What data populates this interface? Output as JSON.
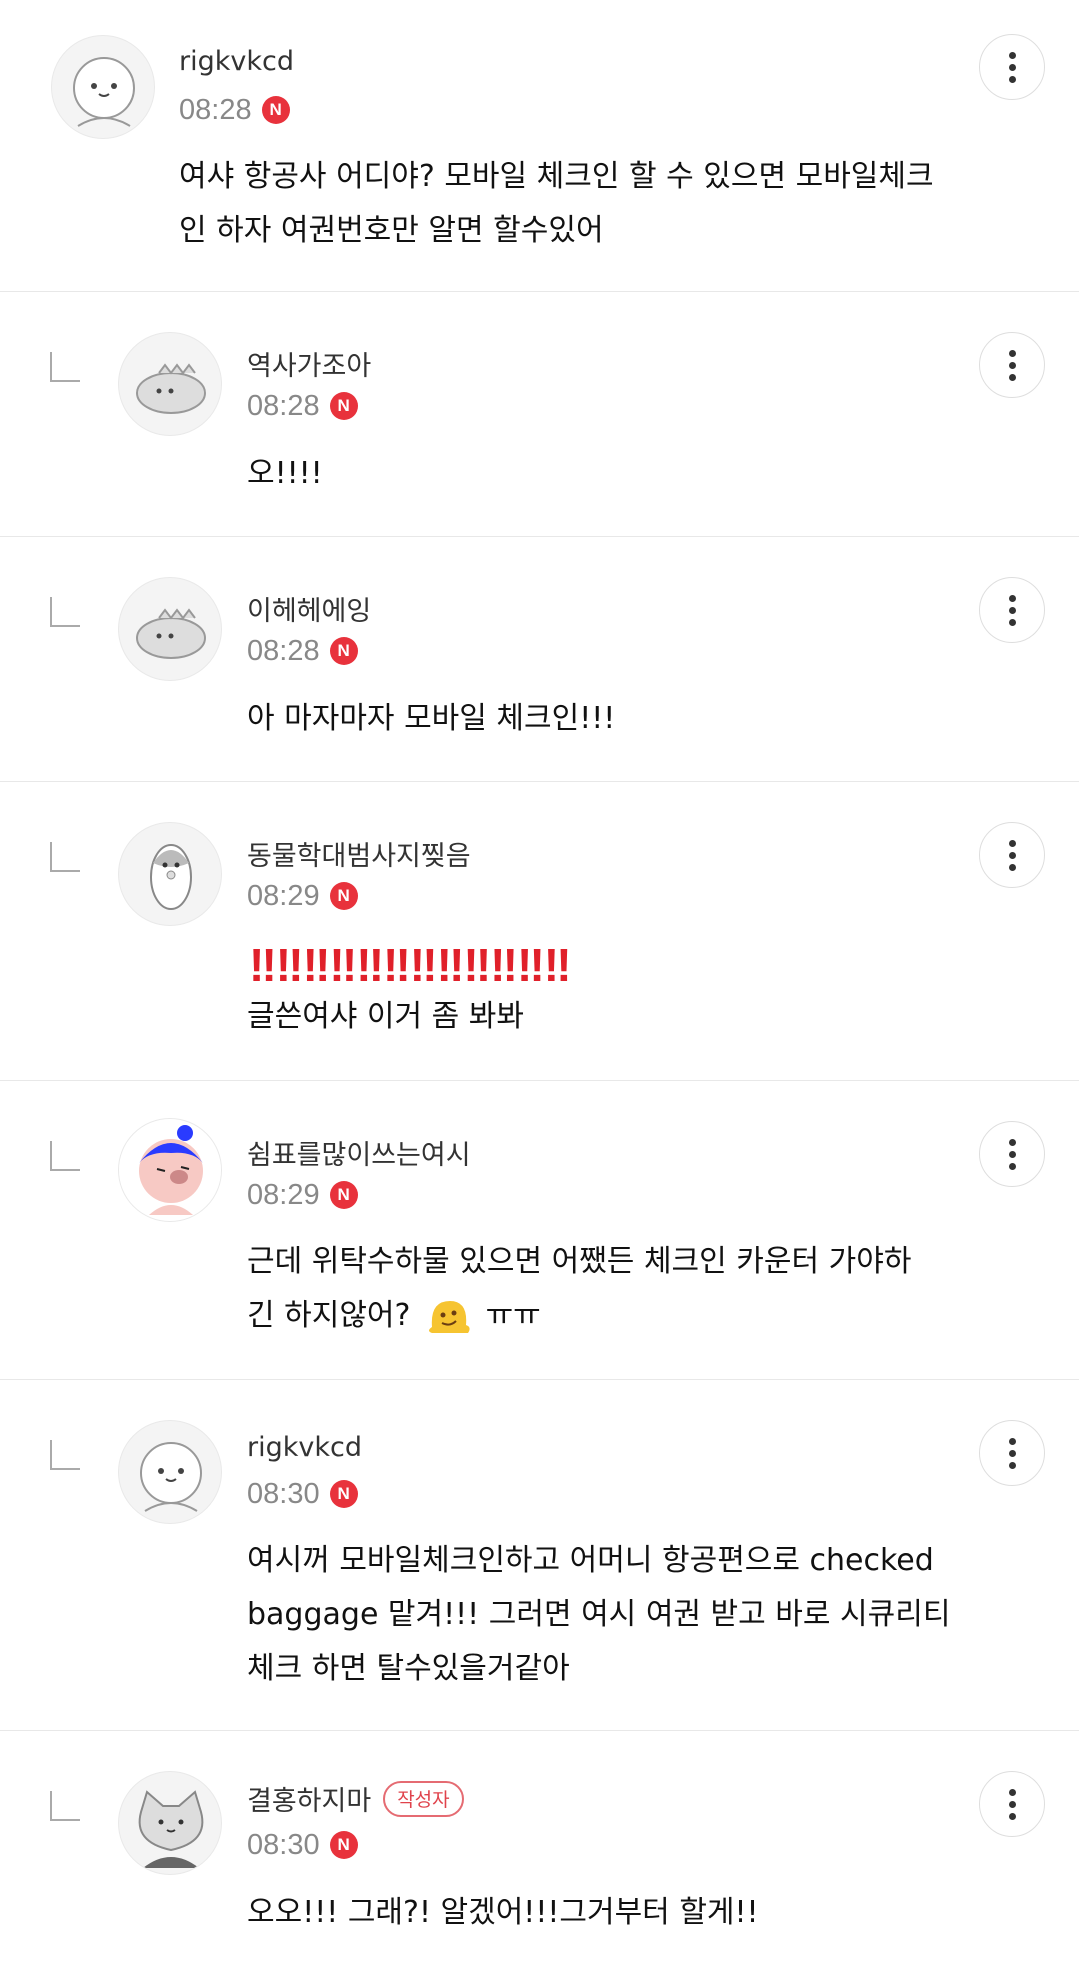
{
  "comments": [
    {
      "nick": "rigkvkcd",
      "time": "08:28",
      "badge": "N",
      "lines": [
        "여샤 항공사 어디야? 모바일 체크인 할 수 있으면 모바일체크",
        "인 하자 여권번호만 알면 할수있어"
      ]
    },
    {
      "nick": "역사가조아",
      "time": "08:28",
      "badge": "N",
      "lines": [
        "오!!!!"
      ]
    },
    {
      "nick": "이헤헤에잉",
      "time": "08:28",
      "badge": "N",
      "lines": [
        "아 마자마자 모바일 체크인!!!"
      ]
    },
    {
      "nick": "동물학대범사지찢음",
      "time": "08:29",
      "badge": "N",
      "bangs": [
        "‼",
        "‼",
        "‼",
        "‼",
        "‼",
        "‼",
        "‼",
        "‼",
        "‼",
        "‼",
        "‼",
        "‼"
      ],
      "lines": [
        "글쓴여샤 이거 좀 봐봐"
      ]
    },
    {
      "nick": "쉼표를많이쓰는여시",
      "time": "08:29",
      "badge": "N",
      "lines": [
        "근데 위탁수하물 있으면 어쨌든 체크인 카운터 가야하",
        "긴 하지않어?"
      ],
      "line2_suffix": "ㅠㅠ"
    },
    {
      "nick": "rigkvkcd",
      "time": "08:30",
      "badge": "N",
      "lines": [
        "여시꺼 모바일체크인하고 어머니 항공편으로 checked",
        "baggage 맡겨!!! 그러면 여시 여권 받고 바로 시큐리티",
        "체크 하면 탈수있을거같아"
      ]
    },
    {
      "nick": "결홍하지마",
      "author_badge": "작성자",
      "time": "08:30",
      "badge": "N",
      "lines": [
        "오오!!! 그래?! 알겠어!!!그거부터 할게!!"
      ]
    }
  ],
  "icons": {
    "more": "more-vertical-icon",
    "reply": "reply-arrow-icon",
    "new": "new-badge-icon",
    "emoji": "melting-face-emoji"
  },
  "colors": {
    "new_badge": "#e8323c",
    "author_badge": "#e0434c",
    "bang": "#e0202a"
  }
}
